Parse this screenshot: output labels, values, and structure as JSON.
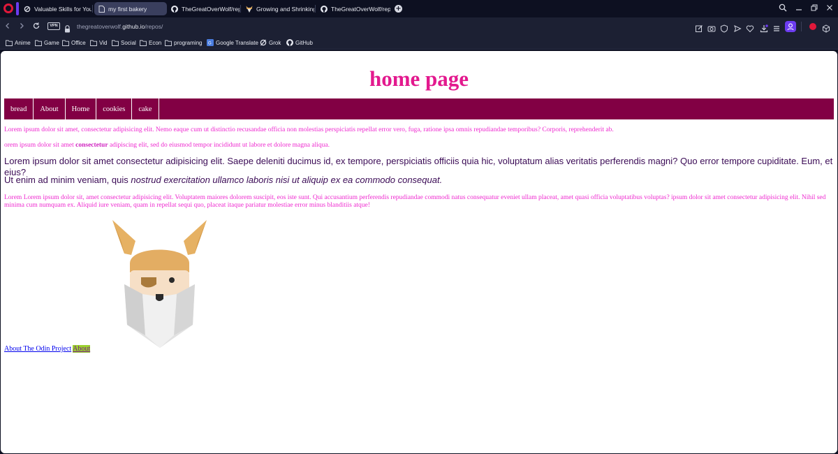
{
  "browser": {
    "tabs": [
      {
        "title": "Valuable Skills for Young A",
        "icon": "loop-icon",
        "active": false
      },
      {
        "title": "my first bakery",
        "icon": "document-icon",
        "active": true
      },
      {
        "title": "TheGreatOverWolf/repos",
        "icon": "github-icon",
        "active": false
      },
      {
        "title": "Growing and Shrinking | T",
        "icon": "odin-icon",
        "active": false
      },
      {
        "title": "TheGreatOverWolf/repos",
        "icon": "github-icon",
        "active": false
      }
    ],
    "vpn_label": "VPN",
    "url": {
      "prefix": "thegreatoverwolf.",
      "domain": "github.io",
      "path": "/repos/"
    },
    "bookmarks": [
      {
        "label": "Anime",
        "icon": "folder-icon"
      },
      {
        "label": "Game",
        "icon": "folder-icon"
      },
      {
        "label": "Office",
        "icon": "folder-icon"
      },
      {
        "label": "Vid",
        "icon": "folder-icon"
      },
      {
        "label": "Social",
        "icon": "folder-icon"
      },
      {
        "label": "Econ",
        "icon": "folder-icon"
      },
      {
        "label": "programing",
        "icon": "folder-icon"
      },
      {
        "label": "Google Translate",
        "icon": "translate-icon"
      },
      {
        "label": "Grok",
        "icon": "grok-icon"
      },
      {
        "label": "GitHub",
        "icon": "github-icon"
      }
    ]
  },
  "page": {
    "title": "home page",
    "nav": [
      "bread",
      "About",
      "Home",
      "cookies",
      "cake"
    ],
    "p1": "Lorem ipsum dolor sit amet, consectetur adipisicing elit. Nemo eaque cum ut distinctio recusandae officia non molestias perspiciatis repellat error vero, fuga, ratione ipsa omnis repudiandae temporibus? Corporis, reprehenderit ab.",
    "p2_before": "orem ipsum dolor sit amet ",
    "p2_bold": "consectetur",
    "p2_after": " adipiscing elit, sed do eiusmod tempor incididunt ut labore et dolore magna aliqua.",
    "p3": "Lorem ipsum dolor sit amet consectetur adipisicing elit. Saepe deleniti ducimus id, ex tempore, perspiciatis officiis quia hic, voluptatum alias veritatis perferendis magni? Quo error tempore cupiditate. Eum, et eius?",
    "p4_before": "Ut enim ad minim veniam, quis ",
    "p4_italic": "nostrud exercitation ullamco laboris nisi ut aliquip ex ea commodo consequat.",
    "p5": "Lorem Lorem ipsum dolor sit, amet consectetur adipisicing elit. Voluptatem maiores dolorem suscipit, eos iste sunt. Qui accusantium perferendis repudiandae commodi natus consequatur eveniet ullam placeat, amet quasi officia voluptatibus voluptas? ipsum dolor sit amet consectetur adipisicing elit. Nihil sed minima cum numquam ex. Aliquid iure veniam, quam in repellat sequi quo, placeat itaque pariatur molestiae error minus blanditiis atque!",
    "link_odin": "About The Odin Project",
    "link_about": "About"
  },
  "colors": {
    "title": "#e3198e",
    "nav_bg": "#820044",
    "pink_text": "#ee28cf",
    "dark_text": "#3a0a55",
    "link_highlight": "#9bd12f"
  }
}
